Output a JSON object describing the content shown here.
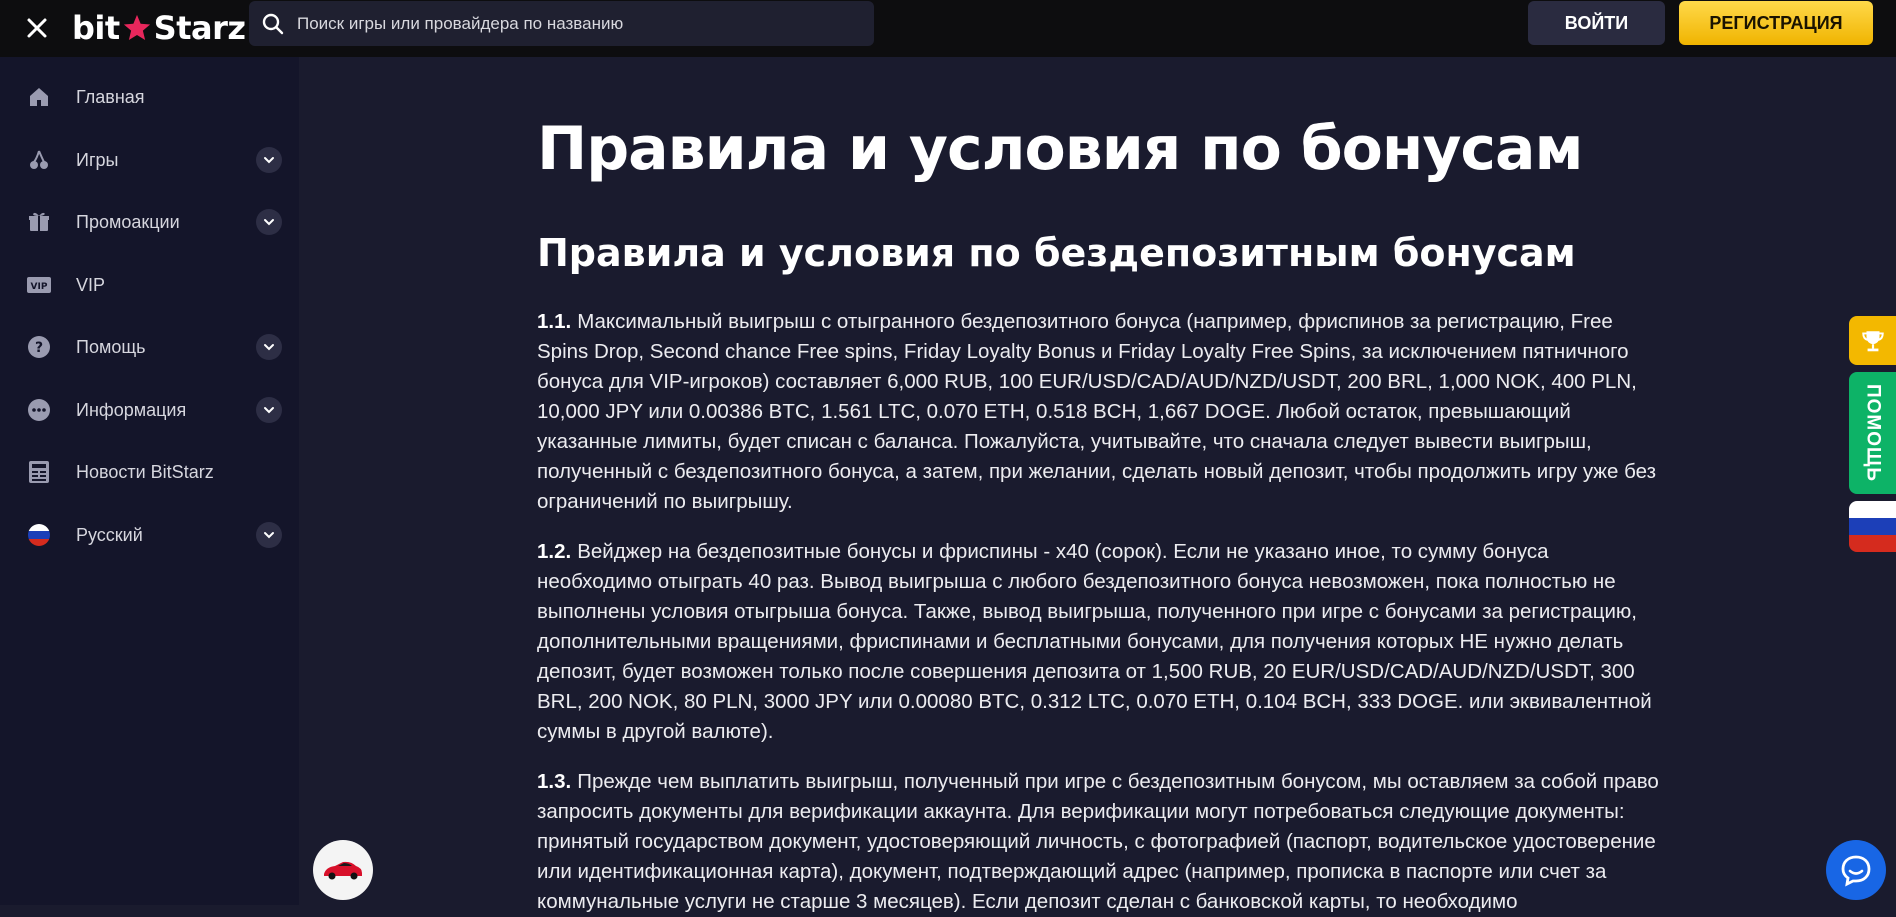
{
  "header": {
    "logo_left": "bit",
    "logo_right": "Starz",
    "search_placeholder": "Поиск игры или провайдера по названию",
    "login_label": "ВОЙТИ",
    "register_label": "РЕГИСТРАЦИЯ"
  },
  "sidebar": {
    "items": [
      {
        "label": "Главная",
        "icon": "home-icon",
        "has_chevron": false
      },
      {
        "label": "Игры",
        "icon": "cherries-icon",
        "has_chevron": true
      },
      {
        "label": "Промоакции",
        "icon": "gift-icon",
        "has_chevron": true
      },
      {
        "label": "VIP",
        "icon": "vip-icon",
        "has_chevron": false
      },
      {
        "label": "Помощь",
        "icon": "help-icon",
        "has_chevron": true
      },
      {
        "label": "Информация",
        "icon": "info-dots-icon",
        "has_chevron": true
      },
      {
        "label": "Новости BitStarz",
        "icon": "news-icon",
        "has_chevron": false
      },
      {
        "label": "Русский",
        "icon": "russia-flag-icon",
        "has_chevron": true
      }
    ]
  },
  "main": {
    "title": "Правила и условия по бонусам",
    "subtitle": "Правила и условия по бездепозитным бонусам",
    "paragraphs": [
      {
        "num": "1.1.",
        "text": "Максимальный выигрыш с отыгранного бездепозитного бонуса (например, фриспинов за регистрацию, Free Spins Drop, Second chance Free spins, Friday Loyalty Bonus и Friday Loyalty Free Spins, за исключением пятничного бонуса для VIP-игроков) составляет 6,000 RUB, 100 EUR/USD/CAD/AUD/NZD/USDT, 200 BRL, 1,000 NOK, 400 PLN, 10,000 JPY или 0.00386 BTC, 1.561 LTC, 0.070 ETH, 0.518 BCH, 1,667 DOGE. Любой остаток, превышающий указанные лимиты, будет списан с баланса. Пожалуйста, учитывайте, что сначала следует вывести выигрыш, полученный с бездепозитного бонуса, а затем, при желании, сделать новый депозит, чтобы продолжить игру уже без ограничений по выигрышу."
      },
      {
        "num": "1.2.",
        "text": "Вейджер на бездепозитные бонусы и фриспины - x40 (сорок). Если не указано иное, то сумму бонуса необходимо отыграть 40 раз. Вывод выигрыша с любого бездепозитного бонуса невозможен, пока полностью не выполнены условия отыгрыша бонуса. Также, вывод выигрыша, полученного при игре с бонусами за регистрацию, дополнительными вращениями, фриспинами и бесплатными бонусами, для получения которых НЕ нужно делать депозит, будет возможен только после совершения депозита от 1,500 RUB, 20 EUR/USD/CAD/AUD/NZD/USDT, 300 BRL, 200 NOK, 80 PLN, 3000 JPY или 0.00080 BTC, 0.312 LTC, 0.070 ETH, 0.104 BCH, 333 DOGE. или эквивалентной суммы в другой валюте)."
      },
      {
        "num": "1.3.",
        "text": "Прежде чем выплатить выигрыш, полученный при игре с бездепозитным бонусом, мы оставляем за собой право запросить документы для верификации аккаунта. Для верификации могут потребоваться следующие документы: принятый государством документ, удостоверяющий личность, с фотографией (паспорт, водительское удостоверение или идентификационная карта), документ, подтверждающий адрес (например, прописка в паспорте или счет за коммунальные услуги не старше 3 месяцев). Если депозит сделан с банковской карты, то необходимо"
      }
    ]
  },
  "floating": {
    "help_tab_label": "ПОМОЩЬ"
  },
  "colors": {
    "page_bg": "#1a1b2e",
    "sidebar_bg": "#14152a",
    "topbar_bg": "#0d0d0f",
    "accent_yellow": "#f3b800",
    "help_green": "#0db367",
    "chat_blue": "#1866e5",
    "logo_star": "#e8275c"
  }
}
